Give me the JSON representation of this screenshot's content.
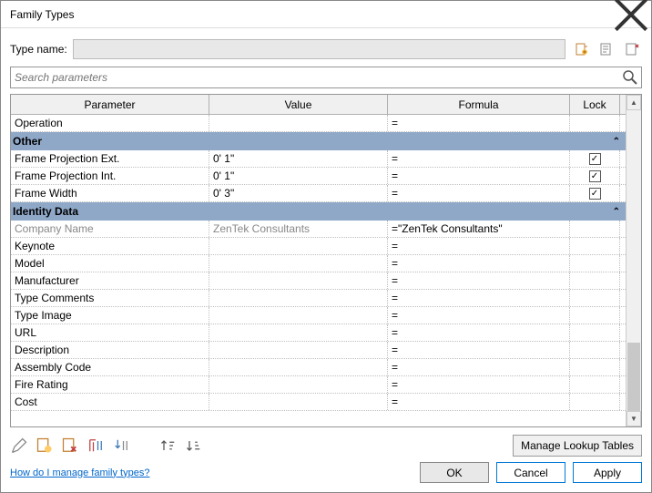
{
  "window": {
    "title": "Family Types"
  },
  "typename": {
    "label": "Type name:",
    "value": ""
  },
  "search": {
    "placeholder": "Search parameters"
  },
  "headers": {
    "parameter": "Parameter",
    "value": "Value",
    "formula": "Formula",
    "lock": "Lock"
  },
  "rows_top": [
    {
      "param": "Operation",
      "value": "",
      "formula": "=",
      "lock": null
    }
  ],
  "group_other": "Other",
  "rows_other": [
    {
      "param": "Frame Projection Ext.",
      "value": "0'  1\"",
      "formula": "=",
      "lock": true
    },
    {
      "param": "Frame Projection Int.",
      "value": "0'  1\"",
      "formula": "=",
      "lock": true
    },
    {
      "param": "Frame Width",
      "value": "0'  3\"",
      "formula": "=",
      "lock": true
    }
  ],
  "group_identity": "Identity Data",
  "rows_identity": [
    {
      "param": "Company Name",
      "value": "ZenTek Consultants",
      "formula": "=\"ZenTek Consultants\"",
      "lock": null,
      "gray": true
    },
    {
      "param": "Keynote",
      "value": "",
      "formula": "=",
      "lock": null
    },
    {
      "param": "Model",
      "value": "",
      "formula": "=",
      "lock": null
    },
    {
      "param": "Manufacturer",
      "value": "",
      "formula": "=",
      "lock": null
    },
    {
      "param": "Type Comments",
      "value": "",
      "formula": "=",
      "lock": null
    },
    {
      "param": "Type Image",
      "value": "",
      "formula": "=",
      "lock": null
    },
    {
      "param": "URL",
      "value": "",
      "formula": "=",
      "lock": null
    },
    {
      "param": "Description",
      "value": "",
      "formula": "=",
      "lock": null
    },
    {
      "param": "Assembly Code",
      "value": "",
      "formula": "=",
      "lock": null
    },
    {
      "param": "Fire Rating",
      "value": "",
      "formula": "=",
      "lock": null
    },
    {
      "param": "Cost",
      "value": "",
      "formula": "=",
      "lock": null
    }
  ],
  "buttons": {
    "manage_lookup": "Manage Lookup Tables",
    "ok": "OK",
    "cancel": "Cancel",
    "apply": "Apply"
  },
  "help_link": "How do I manage family types?"
}
